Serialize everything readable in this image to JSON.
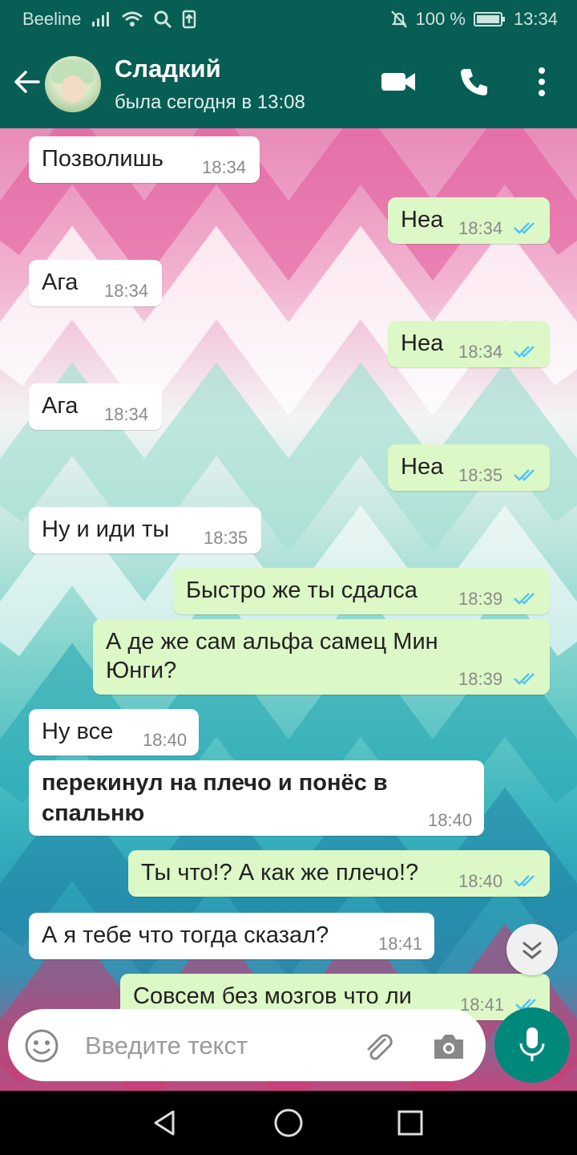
{
  "status_bar": {
    "carrier": "Beeline",
    "battery": "100 %",
    "time": "13:34"
  },
  "header": {
    "contact_name": "Сладкий",
    "last_seen": "была сегодня в 13:08"
  },
  "messages": [
    {
      "text": "Позволишь",
      "time": "18:34",
      "direction": "in"
    },
    {
      "text": "Неа",
      "time": "18:34",
      "direction": "out"
    },
    {
      "text": "Ага",
      "time": "18:34",
      "direction": "in"
    },
    {
      "text": "Неа",
      "time": "18:34",
      "direction": "out"
    },
    {
      "text": "Ага",
      "time": "18:34",
      "direction": "in"
    },
    {
      "text": "Неа",
      "time": "18:35",
      "direction": "out"
    },
    {
      "text": "Ну и иди ты",
      "time": "18:35",
      "direction": "in"
    },
    {
      "text": "Быстро же ты сдалса",
      "time": "18:39",
      "direction": "out"
    },
    {
      "line1": "А де же сам альфа самец Мин",
      "line2": "Юнги?",
      "time": "18:39",
      "direction": "out"
    },
    {
      "text": "Ну все",
      "time": "18:40",
      "direction": "in"
    },
    {
      "line1": "перекинул на плечо и понёс в",
      "line2": "спальню",
      "time": "18:40",
      "direction": "in"
    },
    {
      "text": "Ты что!? А как же плечо!?",
      "time": "18:40",
      "direction": "out"
    },
    {
      "text": "А я тебе что тогда сказал?",
      "time": "18:41",
      "direction": "in"
    },
    {
      "text": "Совсем без мозгов что ли",
      "time": "18:41",
      "direction": "out"
    }
  ],
  "input": {
    "placeholder": "Введите текст"
  },
  "colors": {
    "header": "#075e54",
    "outgoing": "#dcf8c6",
    "incoming": "#ffffff",
    "ticks": "#4fc3f7",
    "mic": "#00897b"
  },
  "icons": [
    "back-arrow-icon",
    "video-call-icon",
    "phone-icon",
    "more-vert-icon",
    "scroll-down-icon",
    "emoji-icon",
    "attach-icon",
    "camera-icon",
    "mic-icon",
    "nav-back-icon",
    "nav-home-icon",
    "nav-recents-icon"
  ]
}
